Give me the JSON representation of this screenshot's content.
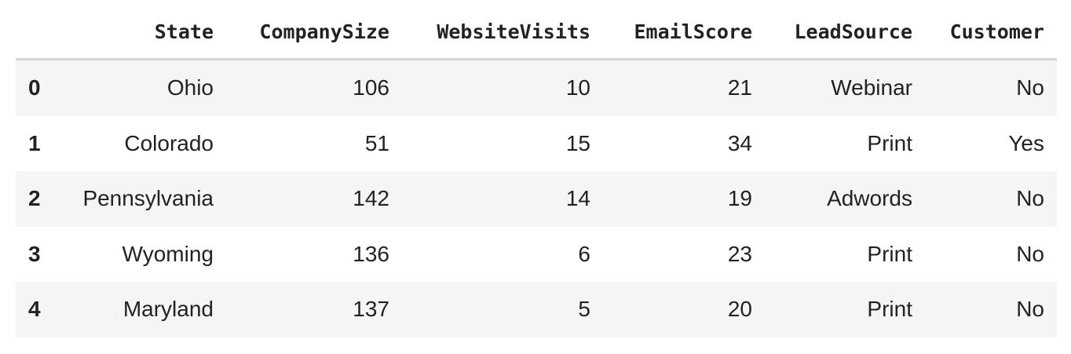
{
  "table": {
    "columns": [
      "",
      "State",
      "CompanySize",
      "WebsiteVisits",
      "EmailScore",
      "LeadSource",
      "Customer"
    ],
    "rows": [
      {
        "index": "0",
        "State": "Ohio",
        "CompanySize": "106",
        "WebsiteVisits": "10",
        "EmailScore": "21",
        "LeadSource": "Webinar",
        "Customer": "No"
      },
      {
        "index": "1",
        "State": "Colorado",
        "CompanySize": "51",
        "WebsiteVisits": "15",
        "EmailScore": "34",
        "LeadSource": "Print",
        "Customer": "Yes"
      },
      {
        "index": "2",
        "State": "Pennsylvania",
        "CompanySize": "142",
        "WebsiteVisits": "14",
        "EmailScore": "19",
        "LeadSource": "Adwords",
        "Customer": "No"
      },
      {
        "index": "3",
        "State": "Wyoming",
        "CompanySize": "136",
        "WebsiteVisits": "6",
        "EmailScore": "23",
        "LeadSource": "Print",
        "Customer": "No"
      },
      {
        "index": "4",
        "State": "Maryland",
        "CompanySize": "137",
        "WebsiteVisits": "5",
        "EmailScore": "20",
        "LeadSource": "Print",
        "Customer": "No"
      }
    ]
  },
  "colors": {
    "stripe": "#f5f5f5",
    "header_rule": "#d6d6d6",
    "text": "#222222"
  }
}
